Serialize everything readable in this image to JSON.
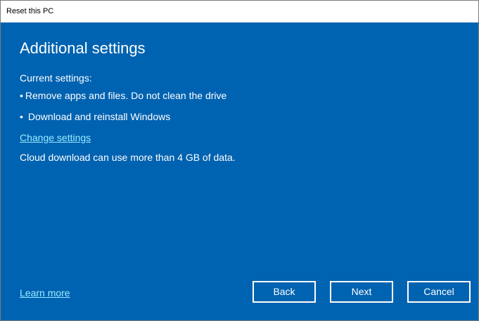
{
  "window": {
    "title": "Reset this PC"
  },
  "page": {
    "heading": "Additional settings",
    "current_label": "Current settings:",
    "bullets": [
      "Remove apps and files. Do not clean the drive",
      "Download and reinstall Windows"
    ],
    "bullet_glyph": "•",
    "change_settings_link": "Change settings",
    "cloud_note": "Cloud download can use more than 4 GB of data."
  },
  "footer": {
    "learn_more_link": "Learn more",
    "back_label": "Back",
    "next_label": "Next",
    "cancel_label": "Cancel"
  },
  "colors": {
    "background": "#0063b1",
    "link": "#99ebff",
    "text": "#ffffff"
  }
}
